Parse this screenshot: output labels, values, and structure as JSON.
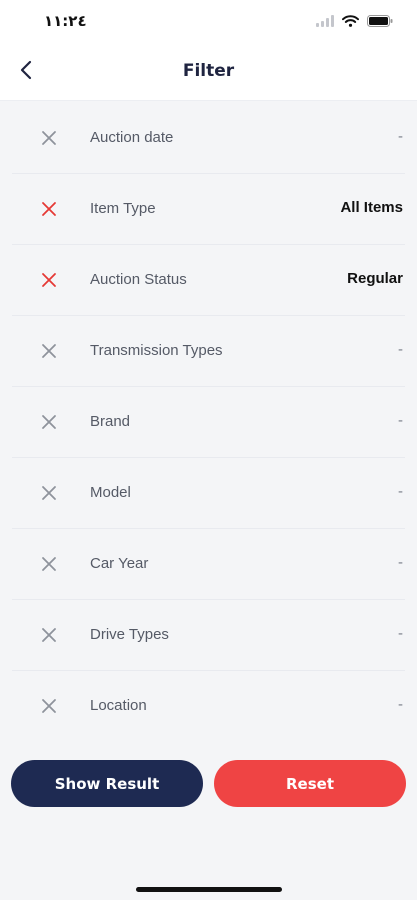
{
  "status_bar": {
    "time": "١١:٢٤"
  },
  "header": {
    "title": "Filter"
  },
  "filters": [
    {
      "label": "Auction date",
      "value": "-",
      "active": false
    },
    {
      "label": "Item Type",
      "value": "All Items",
      "active": true
    },
    {
      "label": "Auction Status",
      "value": "Regular",
      "active": true
    },
    {
      "label": "Transmission Types",
      "value": "-",
      "active": false
    },
    {
      "label": "Brand",
      "value": "-",
      "active": false
    },
    {
      "label": "Model",
      "value": "-",
      "active": false
    },
    {
      "label": "Car Year",
      "value": "-",
      "active": false
    },
    {
      "label": "Drive Types",
      "value": "-",
      "active": false
    },
    {
      "label": "Location",
      "value": "-",
      "active": false
    }
  ],
  "actions": {
    "show_result_label": "Show Result",
    "reset_label": "Reset"
  },
  "icons": {
    "back": "chevron-left-icon",
    "clear": "close-icon",
    "signal": "signal-icon",
    "wifi": "wifi-icon",
    "battery": "battery-icon"
  },
  "colors": {
    "navy": "#1e2a52",
    "red": "#ef4444",
    "active_clear": "#e53935",
    "inactive_clear": "#8e939c",
    "background": "#f4f5f7"
  }
}
